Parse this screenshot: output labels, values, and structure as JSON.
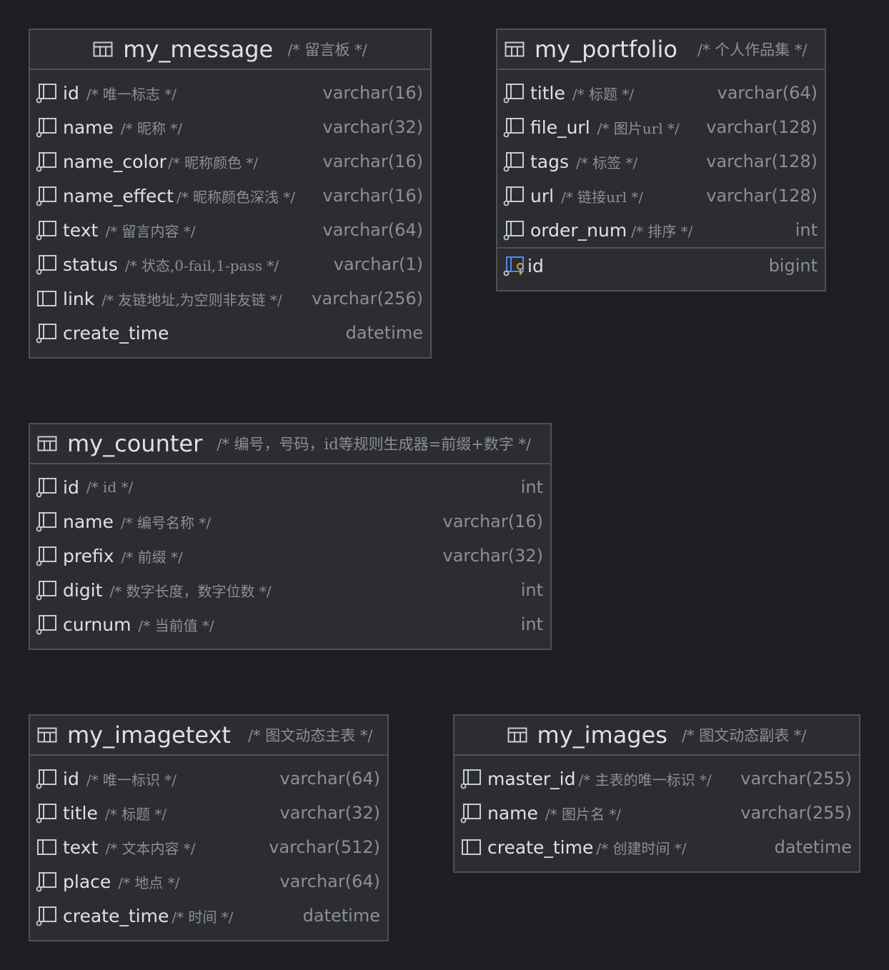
{
  "tables": {
    "my_message": {
      "name": "my_message",
      "comment": "/* 留言板 */",
      "columns": [
        {
          "name": "id",
          "comment": "/* 唯一标志 */",
          "type": "varchar(16)"
        },
        {
          "name": "name",
          "comment": "/* 昵称 */",
          "type": "varchar(32)"
        },
        {
          "name": "name_color",
          "comment": "/* 昵称颜色 */",
          "type": "varchar(16)"
        },
        {
          "name": "name_effect",
          "comment": "/* 昵称颜色深浅 */",
          "type": "varchar(16)"
        },
        {
          "name": "text",
          "comment": "/* 留言内容 */",
          "type": "varchar(64)"
        },
        {
          "name": "status",
          "comment": "/* 状态,0-fail,1-pass */",
          "type": "varchar(1)"
        },
        {
          "name": "link",
          "comment": "/* 友链地址,为空则非友链 */",
          "type": "varchar(256)"
        },
        {
          "name": "create_time",
          "comment": "",
          "type": "datetime"
        }
      ]
    },
    "my_portfolio": {
      "name": "my_portfolio",
      "comment": "/* 个人作品集 */",
      "columns": [
        {
          "name": "title",
          "comment": "/* 标题 */",
          "type": "varchar(64)"
        },
        {
          "name": "file_url",
          "comment": "/* 图片url */",
          "type": "varchar(128)"
        },
        {
          "name": "tags",
          "comment": "/* 标签 */",
          "type": "varchar(128)"
        },
        {
          "name": "url",
          "comment": "/* 链接url */",
          "type": "varchar(128)"
        },
        {
          "name": "order_num",
          "comment": "/* 排序 */",
          "type": "int"
        }
      ],
      "primary_key": {
        "name": "id",
        "type": "bigint"
      }
    },
    "my_counter": {
      "name": "my_counter",
      "comment": "/* 编号，号码，id等规则生成器=前缀+数字 */",
      "columns": [
        {
          "name": "id",
          "comment": "/* id */",
          "type": "int"
        },
        {
          "name": "name",
          "comment": "/* 编号名称 */",
          "type": "varchar(16)"
        },
        {
          "name": "prefix",
          "comment": "/* 前缀 */",
          "type": "varchar(32)"
        },
        {
          "name": "digit",
          "comment": "/* 数字长度，数字位数 */",
          "type": "int"
        },
        {
          "name": "curnum",
          "comment": "/* 当前值 */",
          "type": "int"
        }
      ]
    },
    "my_imagetext": {
      "name": "my_imagetext",
      "comment": "/* 图文动态主表 */",
      "columns": [
        {
          "name": "id",
          "comment": "/* 唯一标识 */",
          "type": "varchar(64)"
        },
        {
          "name": "title",
          "comment": "/* 标题 */",
          "type": "varchar(32)"
        },
        {
          "name": "text",
          "comment": "/* 文本内容 */",
          "type": "varchar(512)"
        },
        {
          "name": "place",
          "comment": "/* 地点 */",
          "type": "varchar(64)"
        },
        {
          "name": "create_time",
          "comment": "/* 时间 */",
          "type": "datetime"
        }
      ]
    },
    "my_images": {
      "name": "my_images",
      "comment": "/* 图文动态副表 */",
      "columns": [
        {
          "name": "master_id",
          "comment": "/* 主表的唯一标识 */",
          "type": "varchar(255)"
        },
        {
          "name": "name",
          "comment": "/* 图片名 */",
          "type": "varchar(255)"
        },
        {
          "name": "create_time",
          "comment": "/* 创建时间 */",
          "type": "datetime"
        }
      ]
    }
  },
  "icons": {
    "table": "table-icon",
    "column_notnull": "column-not-null-icon",
    "column_nullable": "column-nullable-icon",
    "primary_key": "primary-key-column-icon"
  },
  "colors": {
    "background": "#1e1f22",
    "table_bg": "#2b2d30",
    "border": "#4e5157",
    "text": "#dfe1e5",
    "muted": "#8c8f94",
    "key_gold": "#d9a343",
    "key_blue": "#4d8bf0"
  }
}
